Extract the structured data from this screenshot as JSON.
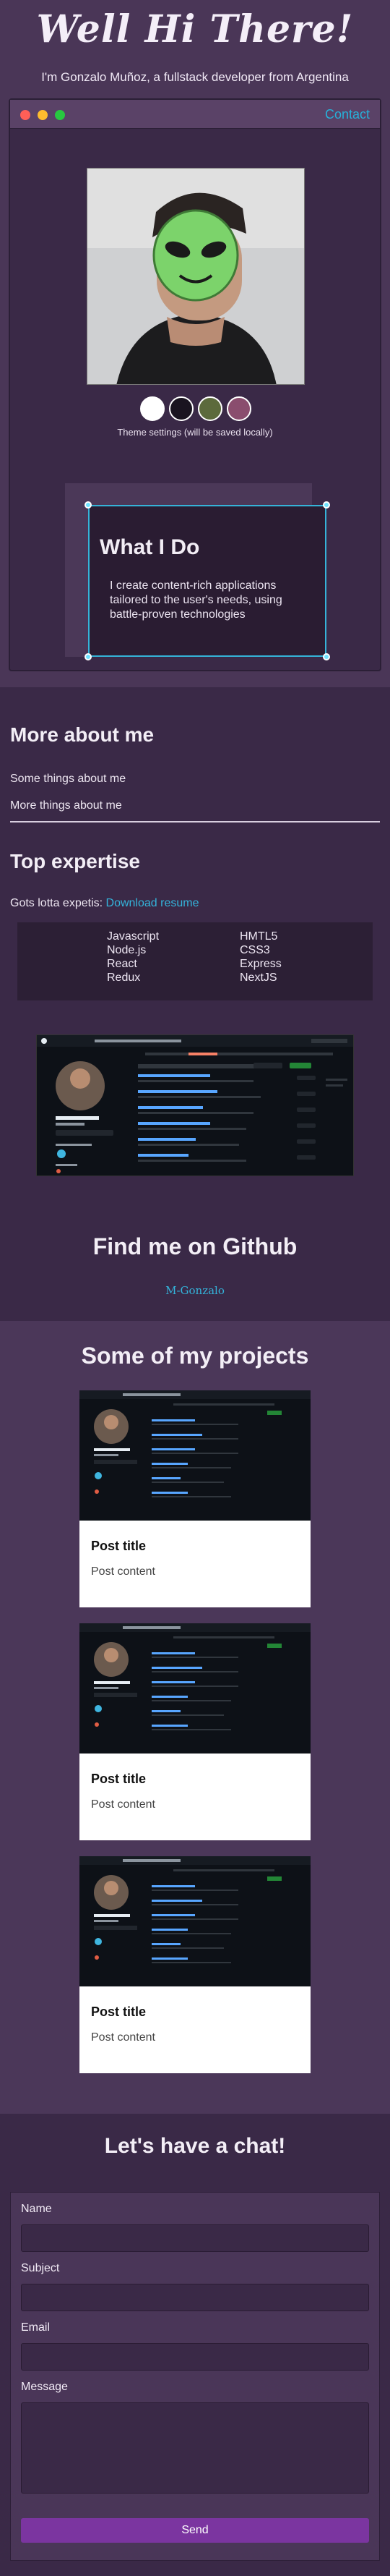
{
  "hero": {
    "title": "Well Hi There!",
    "subtitle": "I'm Gonzalo Muñoz, a fullstack developer from Argentina"
  },
  "window": {
    "contact_label": "Contact",
    "theme_label": "Theme settings (will be saved locally)",
    "theme_swatches": [
      "#ffffff",
      "#1a1420",
      "#5c6a3c",
      "#8a4d6e"
    ],
    "traffic_lights": [
      "#ff5f57",
      "#febc2e",
      "#28c840"
    ]
  },
  "what_i_do": {
    "title": "What I Do",
    "body": "I create content-rich applications tailored to the user's needs, using battle-proven technologies"
  },
  "about": {
    "title": "More about me",
    "line1": "Some things about me",
    "line2": "More things about me",
    "expertise_title": "Top expertise",
    "expertise_text": "Gots lotta expetis: ",
    "resume_label": "Download resume",
    "skills_left": [
      "Javascript",
      "Node.js",
      "React",
      "Redux"
    ],
    "skills_right": [
      "HMTL5",
      "CSS3",
      "Express",
      "NextJS"
    ]
  },
  "github": {
    "title": "Find me on Github",
    "username": "M-Gonzalo"
  },
  "projects": {
    "title": "Some of my projects",
    "cards": [
      {
        "title": "Post title",
        "content": "Post content"
      },
      {
        "title": "Post title",
        "content": "Post content"
      },
      {
        "title": "Post title",
        "content": "Post content"
      }
    ]
  },
  "chat": {
    "title": "Let's have a chat!",
    "name_label": "Name",
    "subject_label": "Subject",
    "email_label": "Email",
    "message_label": "Message",
    "send_label": "Send"
  }
}
